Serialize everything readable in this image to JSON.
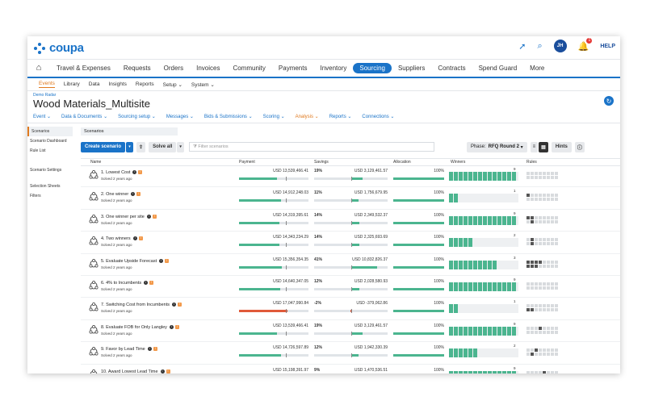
{
  "app": {
    "logo": "coupa"
  },
  "topbar": {
    "avatar_initials": "JH",
    "notification_count": "1",
    "help_label": "HELP"
  },
  "mainnav": {
    "items": [
      "Travel & Expenses",
      "Requests",
      "Orders",
      "Invoices",
      "Community",
      "Payments",
      "Inventory",
      "Sourcing",
      "Suppliers",
      "Contracts",
      "Spend Guard",
      "More"
    ],
    "active": "Sourcing"
  },
  "subnav": {
    "items": [
      "Events",
      "Library",
      "Data",
      "Insights",
      "Reports",
      "Setup ⌄",
      "System ⌄"
    ]
  },
  "breadcrumb": "Demo Radar",
  "page_title": "Wood Materials_Multisite",
  "event_tabs": [
    "Event ⌄",
    "Data & Documents ⌄",
    "Sourcing setup ⌄",
    "Messages ⌄",
    "Bids & Submissions ⌄",
    "Scoring ⌄",
    "Analysis ⌄",
    "Reports ⌄",
    "Connections ⌄"
  ],
  "left_panel": [
    "Scenarios",
    "Scenario Dashboard",
    "Rule List",
    "Scenario Settings",
    "Selection Sheets",
    "Filters"
  ],
  "content_tab": "Scenarios",
  "toolbar": {
    "create_label": "Create scenario",
    "solve_label": "Solve all",
    "filter_placeholder": "Filter scenarios",
    "phase_label": "Phase:",
    "phase_value": "RFQ Round 2",
    "hints_label": "Hints"
  },
  "columns": {
    "name": "Name",
    "payment": "Payment",
    "savings": "Savings",
    "allocation": "Allocation",
    "winners": "Winners",
    "rules": "Rules"
  },
  "rows": [
    {
      "name": "1. Lowest Cost",
      "solved": "Solved 2 years ago",
      "payment": "USD 13,539,466.41",
      "payment_pct": 0.55,
      "savings_pct": "19%",
      "savings": "USD 3,129,461.57",
      "savings_frac": 0.3,
      "allocation": "100%",
      "winners": "9",
      "win_cells": 30,
      "rules_dark": []
    },
    {
      "name": "2. One winner",
      "solved": "Solved 2 years ago",
      "payment": "USD 14,912,248.03",
      "payment_pct": 0.6,
      "savings_pct": "11%",
      "savings": "USD 1,756,679.95",
      "savings_frac": 0.18,
      "allocation": "100%",
      "winners": "1",
      "win_cells": 2,
      "rules_dark": [
        0
      ]
    },
    {
      "name": "3. One winner per site",
      "solved": "Solved 2 years ago",
      "payment": "USD 14,319,395.61",
      "payment_pct": 0.58,
      "savings_pct": "14%",
      "savings": "USD 2,349,532.37",
      "savings_frac": 0.22,
      "allocation": "100%",
      "winners": "9",
      "win_cells": 30,
      "rules_dark": [
        0,
        1,
        9
      ]
    },
    {
      "name": "4. Two winners",
      "solved": "Solved 2 years ago",
      "payment": "USD 14,343,234.29",
      "payment_pct": 0.58,
      "savings_pct": "14%",
      "savings": "USD 2,325,693.69",
      "savings_frac": 0.22,
      "allocation": "100%",
      "winners": "2",
      "win_cells": 5,
      "rules_dark": [
        1,
        9
      ]
    },
    {
      "name": "5. Evaluate Upside Forecast",
      "solved": "Solved 2 years ago",
      "payment": "USD 15,356,354.35",
      "payment_pct": 0.62,
      "savings_pct": "41%",
      "savings": "USD 10,832,826.37",
      "savings_frac": 0.7,
      "allocation": "100%",
      "winners": "3",
      "win_cells": 10,
      "rules_dark": [
        0,
        1,
        2,
        3,
        8,
        9,
        10
      ]
    },
    {
      "name": "6. 4% to Incumbents",
      "solved": "Solved 2 years ago",
      "payment": "USD 14,640,347.05",
      "payment_pct": 0.59,
      "savings_pct": "12%",
      "savings": "USD 2,028,580.93",
      "savings_frac": 0.2,
      "allocation": "100%",
      "winners": "9",
      "win_cells": 30,
      "rules_dark": []
    },
    {
      "name": "7. Switching Cost from Incumbents",
      "solved": "Solved 2 years ago",
      "payment": "USD 17,047,990.84",
      "payment_pct": 0.7,
      "payment_neg": true,
      "savings_pct": "-2%",
      "savings": "USD -379,062.86",
      "savings_frac": 0.03,
      "savings_neg": true,
      "allocation": "100%",
      "winners": "1",
      "win_cells": 2,
      "rules_dark": [
        8,
        9
      ]
    },
    {
      "name": "8. Evaluate FOB for Only Langley",
      "solved": "Solved 2 years ago",
      "payment": "USD 13,539,466.41",
      "payment_pct": 0.55,
      "savings_pct": "19%",
      "savings": "USD 3,129,461.57",
      "savings_frac": 0.3,
      "allocation": "100%",
      "winners": "9",
      "win_cells": 30,
      "rules_dark": [
        3
      ]
    },
    {
      "name": "9. Favor by Lead Time",
      "solved": "Solved 2 years ago",
      "payment": "USD 14,726,597.89",
      "payment_pct": 0.6,
      "savings_pct": "12%",
      "savings": "USD 1,942,330.39",
      "savings_frac": 0.19,
      "allocation": "100%",
      "winners": "2",
      "win_cells": 6,
      "rules_dark": [
        2,
        9
      ]
    },
    {
      "name": "10. Award Lowest Lead Time",
      "solved": "Solved 2 years ago",
      "payment": "USD 15,198,391.97",
      "payment_pct": 0.61,
      "savings_pct": "9%",
      "savings": "USD 1,470,536.51",
      "savings_frac": 0.15,
      "allocation": "100%",
      "winners": "9",
      "win_cells": 30,
      "rules_dark": [
        4
      ]
    }
  ],
  "colors": {
    "brand": "#1a73c8",
    "accent": "#e07a1f",
    "bar": "#4bb58f",
    "negative": "#e05a3a"
  }
}
